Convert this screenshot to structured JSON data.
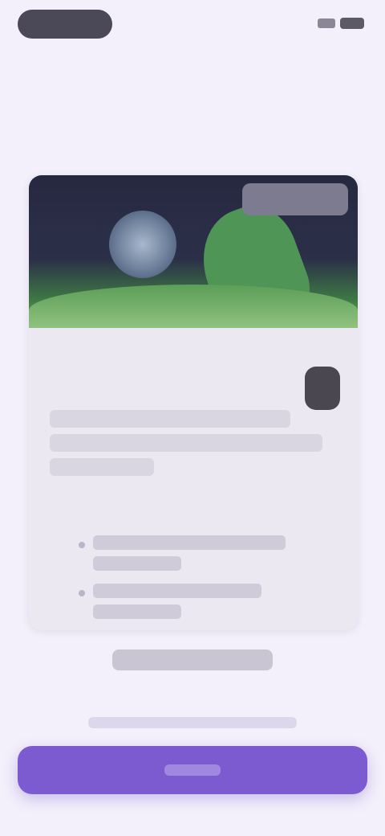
{
  "colors": {
    "accent": "#7c5bd1",
    "background": "#f3f0fb",
    "card": "#ebe8f2"
  },
  "icons": {
    "battery": "battery-icon",
    "signal": "signal-icon"
  }
}
